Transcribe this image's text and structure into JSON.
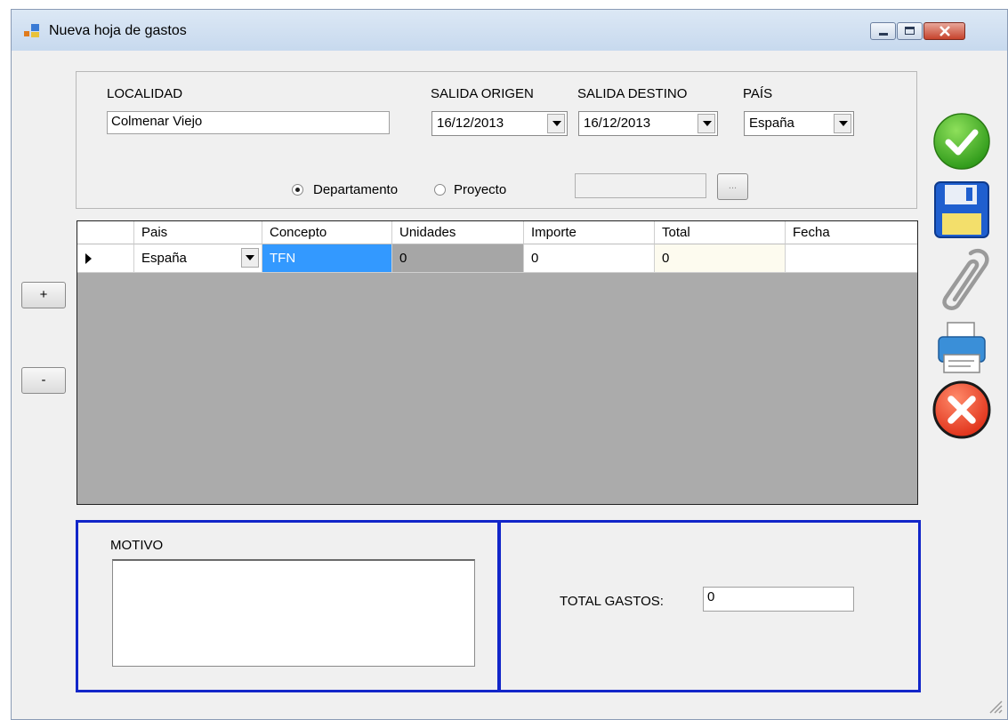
{
  "window": {
    "title": "Nueva hoja de gastos"
  },
  "form": {
    "localidad_label": "LOCALIDAD",
    "localidad_value": "Colmenar Viejo",
    "salida_origen_label": "SALIDA ORIGEN",
    "salida_origen_value": "16/12/2013",
    "salida_destino_label": "SALIDA DESTINO",
    "salida_destino_value": "16/12/2013",
    "pais_label": "PAÍS",
    "pais_value": "España",
    "radio_departamento": "Departamento",
    "radio_proyecto": "Proyecto",
    "radio_selected": "Departamento",
    "browse_label": "...",
    "proyecto_value": ""
  },
  "grid": {
    "columns": [
      "Pais",
      "Concepto",
      "Unidades",
      "Importe",
      "Total",
      "Fecha"
    ],
    "rows": [
      {
        "pais": "España",
        "concepto": "TFN",
        "unidades": "0",
        "importe": "0",
        "total": "0",
        "fecha": ""
      }
    ]
  },
  "side": {
    "add_label": "+",
    "remove_label": "-"
  },
  "footer": {
    "motivo_label": "MOTIVO",
    "motivo_value": "",
    "total_label": "TOTAL GASTOS:",
    "total_value": "0"
  },
  "colors": {
    "accent_border": "#1226c9",
    "selected_cell": "#3399ff",
    "grid_background": "#ababab"
  },
  "icons": [
    "accept-check-icon",
    "save-floppy-icon",
    "attach-paperclip-icon",
    "print-icon",
    "cancel-x-icon"
  ]
}
